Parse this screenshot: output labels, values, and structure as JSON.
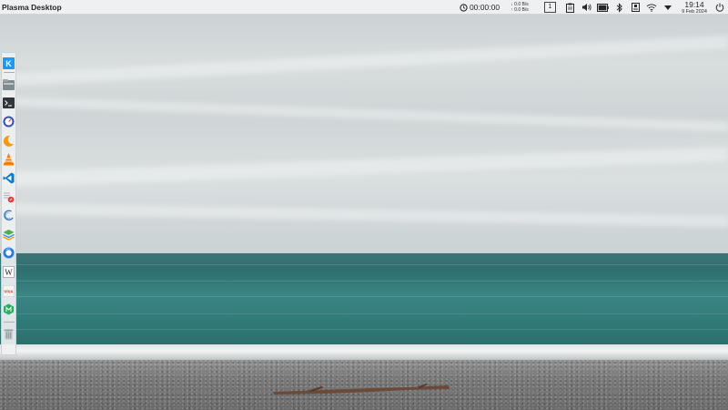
{
  "panel": {
    "app_title": "Plasma Desktop",
    "timer": "00:00:00",
    "net_down": "0.0 B/s",
    "net_up": "0.0 B/s",
    "desktop_number": "1",
    "time": "19:14",
    "date": "9 Feb 2024",
    "tray_icons": [
      "clipboard-icon",
      "volume-icon",
      "battery-icon",
      "bluetooth-icon",
      "device-notifier-icon",
      "wifi-icon",
      "expand-tray-icon"
    ]
  },
  "dock": {
    "launchers": [
      "kde-menu-icon",
      "file-manager-icon",
      "terminal-icon",
      "system-monitor-icon",
      "calendar-icon",
      "vlc-icon",
      "vscode-icon",
      "text-editor-icon",
      "browser-icon",
      "layers-app-icon",
      "firefox-icon",
      "wikipedia-icon",
      "viva-icon",
      "green-app-icon",
      "trash-icon"
    ]
  },
  "colors": {
    "panel_bg": "#eff0f1",
    "sea": "#2f7a78",
    "sky": "#d8ddde",
    "beach": "#777777",
    "accent": "#1d99f3"
  }
}
